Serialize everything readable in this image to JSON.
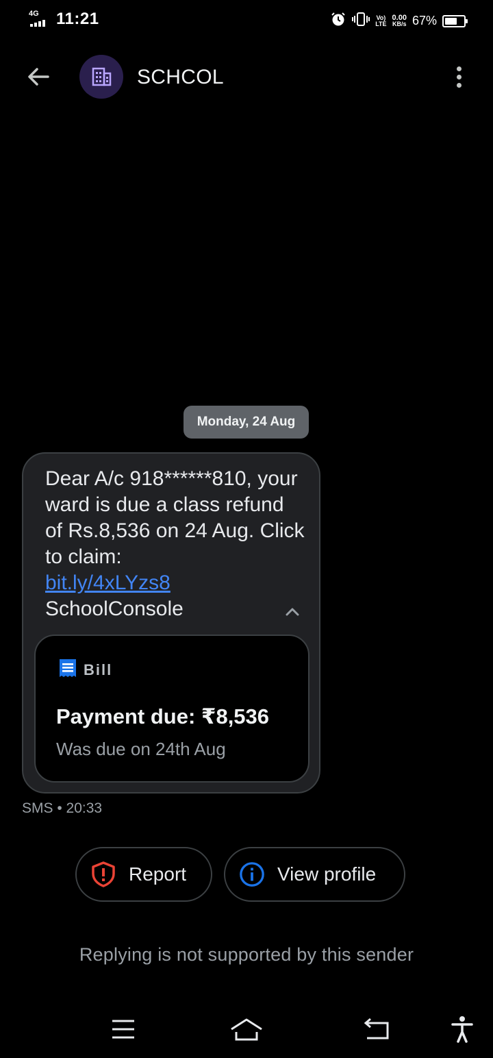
{
  "status_bar": {
    "network": "4G",
    "time": "11:21",
    "volte_top": "Vo)",
    "volte_bottom": "LTE",
    "speed_value": "0.00",
    "speed_unit": "KB/s",
    "battery_percent": "67%",
    "battery_level": 0.67
  },
  "header": {
    "title": "SCHCOL",
    "avatar_icon": "building-icon",
    "back_icon": "arrow-back-icon",
    "menu_icon": "more-vert-icon"
  },
  "conversation": {
    "date_chip": "Monday, 24 Aug",
    "message": {
      "text_before_link": "Dear A/c 918******810, your ward is due a class refund of Rs.8,536 on 24 Aug. Click to claim:",
      "link": "bit.ly/4xLYzs8",
      "signature": "SchoolConsole",
      "meta": "SMS • 20:33"
    },
    "bill_card": {
      "label": "Bill",
      "amount": "Payment due: ₹8,536",
      "due_note": "Was due on 24th Aug"
    }
  },
  "actions": {
    "report_label": "Report",
    "view_profile_label": "View profile"
  },
  "reply_note": "Replying is not supported by this sender",
  "colors": {
    "background": "#000000",
    "bubble": "#202124",
    "link": "#4285f4",
    "report_red": "#ea4335",
    "info_blue": "#1a73e8",
    "avatar_bg": "#2a1f4d",
    "avatar_icon": "#b9a6ff",
    "bill_icon": "#1a73e8"
  }
}
